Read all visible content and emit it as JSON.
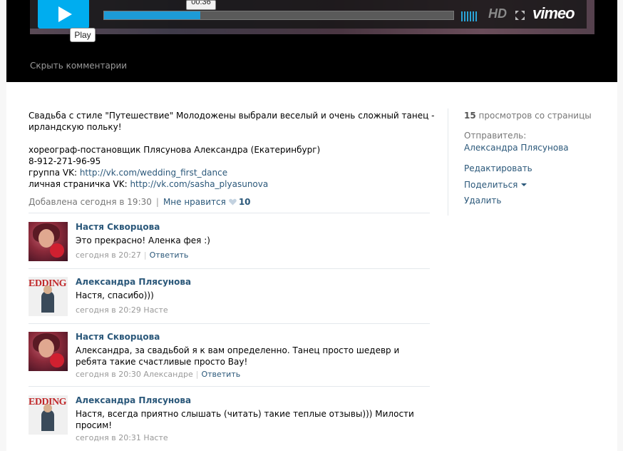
{
  "player": {
    "play_tooltip": "Play",
    "time_tooltip": "00:36",
    "progress": 0.275,
    "hd_label": "HD",
    "vimeo_logo": "vimeo",
    "hide_comments": "Скрыть комментарии",
    "accent_color": "#00adef"
  },
  "video": {
    "description": [
      "Свадьба с стиле \"Путешествие\" Молодожены выбрали веселый и очень сложный танец -",
      "ирландскую польку!",
      "",
      "хореограф-постановщик Плясунова Александра (Екатеринбург)",
      "8-912-271-96-95"
    ],
    "group_label": "группа VK: ",
    "group_link": "http://vk.com/wedding_first_dance",
    "page_label": "личная страничка VK: ",
    "page_link": "http://vk.com/sasha_plyasunova",
    "added": "Добавлена сегодня в 19:30",
    "like_label": "Мне нравится",
    "like_count": "10"
  },
  "comments": [
    {
      "author": "Настя Скворцова",
      "text": "Это прекрасно! Аленка фея :)",
      "time": "сегодня в 20:27",
      "reply_to": "",
      "reply_label": "Ответить",
      "avatar": "nastya"
    },
    {
      "author": "Александра Плясунова",
      "text": "Настя, спасибо)))",
      "time": "сегодня в 20:29",
      "reply_to": "Насте",
      "reply_label": "",
      "avatar": "alex"
    },
    {
      "author": "Настя Скворцова",
      "text": "Александра, за свадьбой я к вам определенно. Танец просто шедевр и ребята такие счастливые просто Вау!",
      "time": "сегодня в 20:30",
      "reply_to": "Александре",
      "reply_label": "Ответить",
      "avatar": "nastya"
    },
    {
      "author": "Александра Плясунова",
      "text": "Настя, всегда приятно слышать (читать) такие теплые отзывы))) Милости просим!",
      "time": "сегодня в 20:31",
      "reply_to": "Насте",
      "reply_label": "",
      "avatar": "alex"
    }
  ],
  "sidebar": {
    "views_count": "15",
    "views_label": " просмотров со страницы",
    "sender_label": "Отправитель:",
    "sender_name": "Александра Плясунова",
    "edit": "Редактировать",
    "share": "Поделиться",
    "delete": "Удалить"
  },
  "avatar_logo_text": "EDDING"
}
